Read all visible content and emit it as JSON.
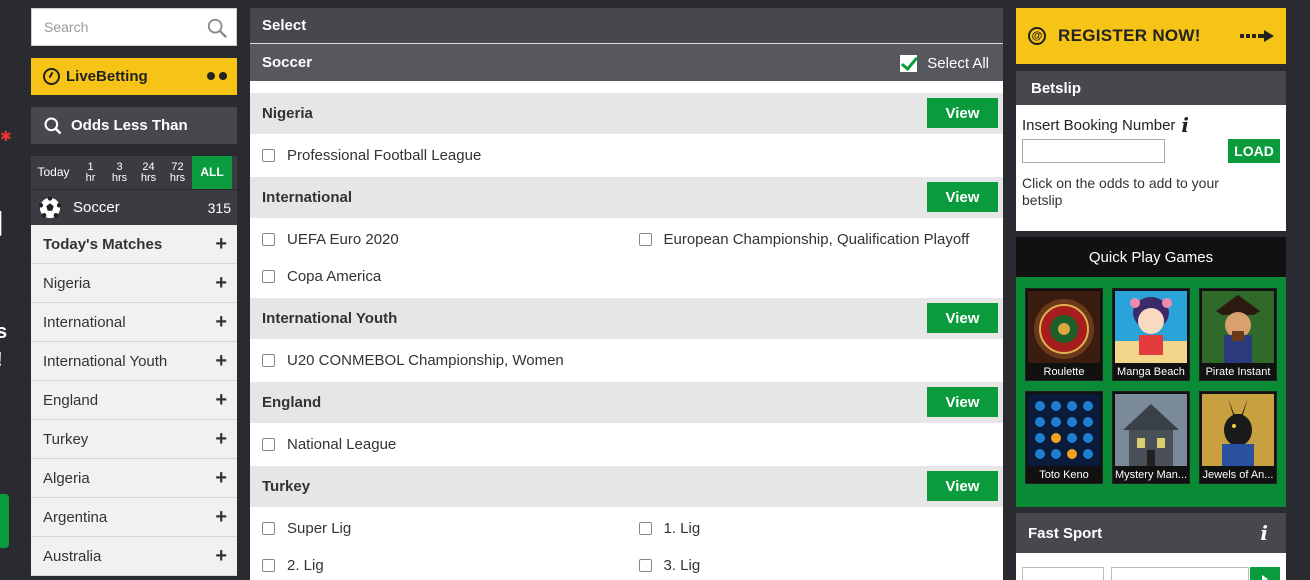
{
  "search": {
    "placeholder": "Search"
  },
  "sidebar": {
    "live_betting": "LiveBetting",
    "odds_less_than": "Odds Less Than",
    "time_filters": [
      {
        "line1": "Today",
        "line2": ""
      },
      {
        "line1": "1",
        "line2": "hr"
      },
      {
        "line1": "3",
        "line2": "hrs"
      },
      {
        "line1": "24",
        "line2": "hrs"
      },
      {
        "line1": "72",
        "line2": "hrs"
      },
      {
        "line1": "ALL",
        "line2": ""
      }
    ],
    "sport": {
      "name": "Soccer",
      "count": "315"
    },
    "items": [
      {
        "label": "Today's Matches"
      },
      {
        "label": "Nigeria"
      },
      {
        "label": "International"
      },
      {
        "label": "International Youth"
      },
      {
        "label": "England"
      },
      {
        "label": "Turkey"
      },
      {
        "label": "Algeria"
      },
      {
        "label": "Argentina"
      },
      {
        "label": "Australia"
      }
    ],
    "plus": "+"
  },
  "main": {
    "header": "Select",
    "sport": "Soccer",
    "select_all": "Select All",
    "view_label": "View",
    "regions": [
      {
        "name": "Nigeria",
        "leagues": [
          "Professional Football League"
        ]
      },
      {
        "name": "International",
        "leagues": [
          "UEFA Euro 2020",
          "European Championship, Qualification Playoff",
          "Copa America"
        ]
      },
      {
        "name": "International Youth",
        "leagues": [
          "U20 CONMEBOL Championship, Women"
        ]
      },
      {
        "name": "England",
        "leagues": [
          "National League"
        ]
      },
      {
        "name": "Turkey",
        "leagues": [
          "Super Lig",
          "1. Lig",
          "2. Lig",
          "3. Lig"
        ]
      }
    ]
  },
  "right": {
    "register": "REGISTER NOW!",
    "register_icon": "@",
    "betslip": {
      "title": "Betslip",
      "booking_label": "Insert Booking Number",
      "info_icon": "i",
      "load": "LOAD",
      "hint": "Click on the odds to add to your betslip"
    },
    "quick_play": {
      "title": "Quick Play Games",
      "games": [
        "Roulette",
        "Manga Beach",
        "Pirate Instant",
        "Toto Keno",
        "Mystery Man...",
        "Jewels of An..."
      ]
    },
    "fast_sport": {
      "title": "Fast Sport",
      "info_icon": "i"
    }
  },
  "colors": {
    "accent_yellow": "#f6c416",
    "accent_green": "#0a9c3c",
    "panel_dark": "#47484d"
  }
}
